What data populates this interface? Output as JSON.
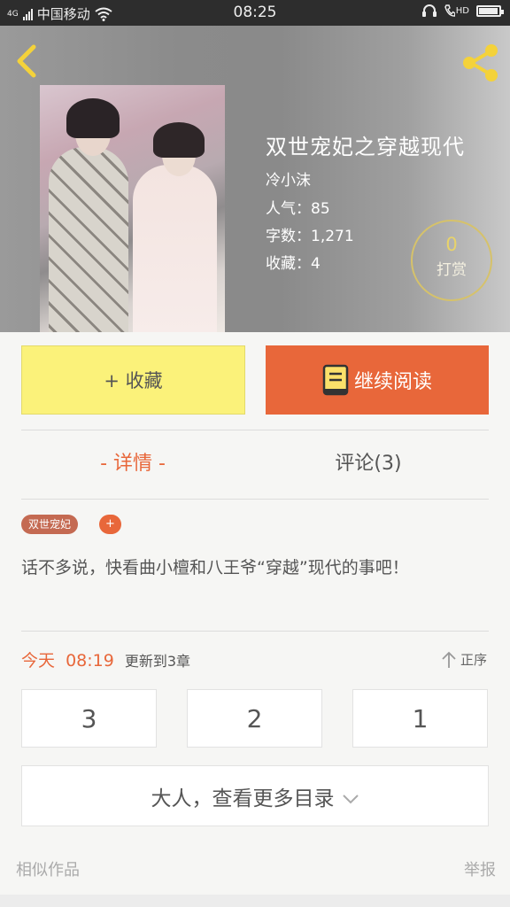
{
  "status_bar": {
    "carrier": "中国移动",
    "network": "4G",
    "time": "08:25",
    "hd": "HD"
  },
  "book": {
    "title": "双世宠妃之穿越现代",
    "author": "冷小沫",
    "popularity": "人气：85",
    "word_count": "字数：1,271",
    "favorites": "收藏：4"
  },
  "reward": {
    "count": "0",
    "label": "打赏"
  },
  "actions": {
    "collect_label": "+ 收藏",
    "read_label": "继续阅读"
  },
  "tabs": {
    "detail": "- 详情 -",
    "comments": "评论(3)"
  },
  "tags": [
    "双世宠妃"
  ],
  "tag_add": "+",
  "description": "话不多说，快看曲小檀和八王爷“穿越”现代的事吧！",
  "update": {
    "today": "今天",
    "time": "08:19",
    "info": "更新到3章"
  },
  "sort_label": "正序",
  "chapters": [
    "3",
    "2",
    "1"
  ],
  "more_catalog": "大人，查看更多目录",
  "footer": {
    "similar": "相似作品",
    "report": "举报"
  },
  "colors": {
    "accent": "#e8673a",
    "collect": "#fbf27a",
    "reward_ring": "#d6c26a"
  }
}
